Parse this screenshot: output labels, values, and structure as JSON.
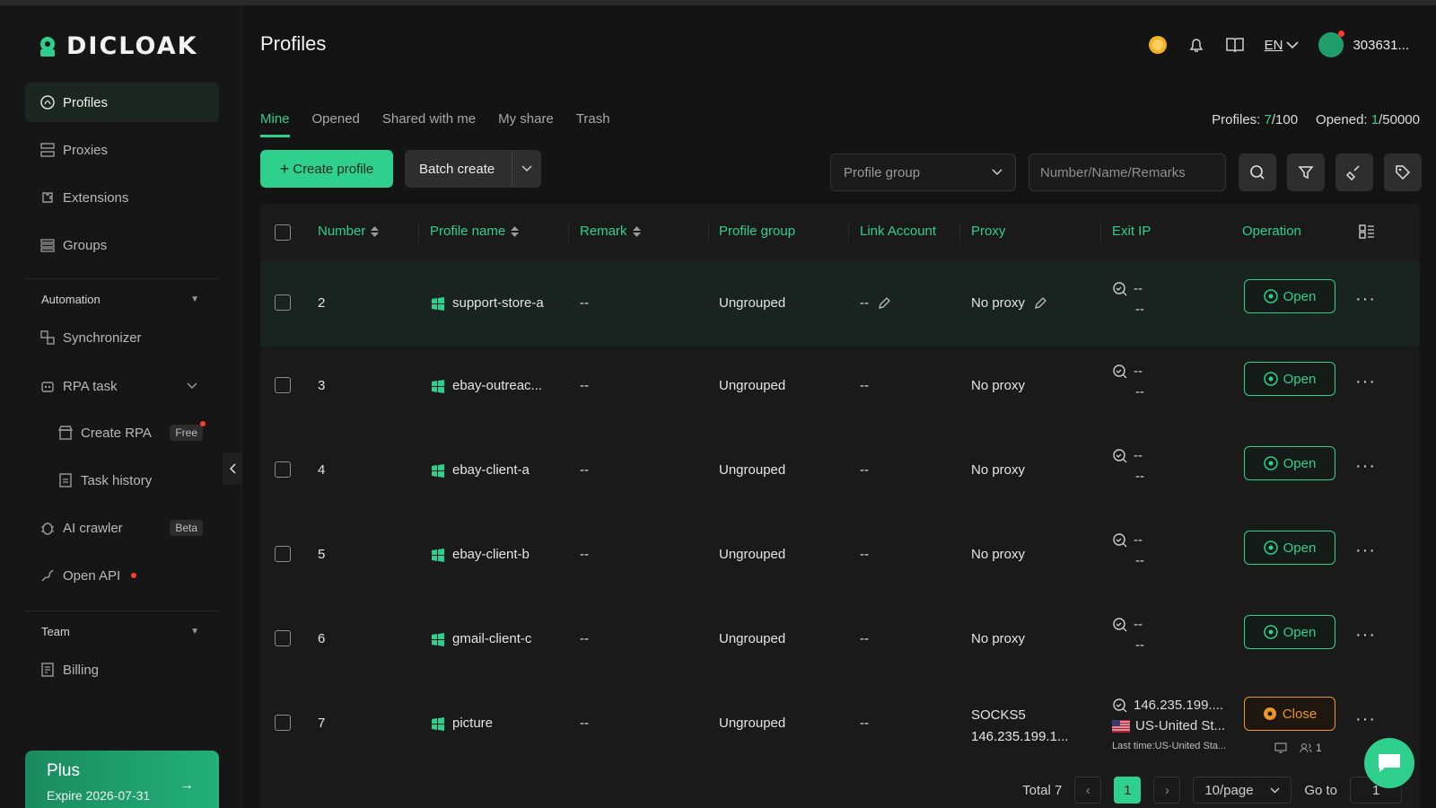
{
  "app": {
    "logo_text": "DICLOAK"
  },
  "colors": {
    "accent": "#2fd08e",
    "warning": "#e8962b",
    "background": "#141414"
  },
  "sidebar": {
    "items": [
      {
        "label": "Profiles",
        "icon": "fingerprint-icon"
      },
      {
        "label": "Proxies",
        "icon": "proxy-icon"
      },
      {
        "label": "Extensions",
        "icon": "extension-icon"
      },
      {
        "label": "Groups",
        "icon": "groups-icon"
      }
    ],
    "automation_title": "Automation",
    "automation_items": [
      {
        "label": "Synchronizer",
        "icon": "sync-icon"
      },
      {
        "label": "RPA task",
        "icon": "robot-icon"
      },
      {
        "label": "Create RPA",
        "icon": "store-icon",
        "badge": "Free"
      },
      {
        "label": "Task history",
        "icon": "document-icon"
      },
      {
        "label": "AI crawler",
        "icon": "bug-icon",
        "badge": "Beta"
      },
      {
        "label": "Open API",
        "icon": "api-icon"
      }
    ],
    "team_title": "Team",
    "team_items": [
      {
        "label": "Billing",
        "icon": "billing-icon"
      }
    ],
    "plan": {
      "name": "Plus",
      "expire": "Expire 2026-07-31"
    }
  },
  "header": {
    "title": "Profiles",
    "language": "EN",
    "user": "303631..."
  },
  "tabs": [
    "Mine",
    "Opened",
    "Shared with me",
    "My share",
    "Trash"
  ],
  "counts": {
    "profiles_label": "Profiles:",
    "profiles_used": "7",
    "profiles_total": "/100",
    "opened_label": "Opened:",
    "opened_used": "1",
    "opened_total": "/50000"
  },
  "toolbar": {
    "create_label": "Create profile",
    "batch_label": "Batch create",
    "group_select": "Profile group",
    "search_placeholder": "Number/Name/Remarks"
  },
  "table": {
    "columns": [
      "Number",
      "Profile name",
      "Remark",
      "Profile group",
      "Link Account",
      "Proxy",
      "Exit IP",
      "Operation"
    ],
    "rows": [
      {
        "number": "2",
        "name": "support-store-a",
        "remark": "--",
        "group": "Ungrouped",
        "link": "--",
        "proxy": "No proxy",
        "exit1": "--",
        "exit2": "--",
        "op": "Open"
      },
      {
        "number": "3",
        "name": "ebay-outreac...",
        "remark": "--",
        "group": "Ungrouped",
        "link": "--",
        "proxy": "No proxy",
        "exit1": "--",
        "exit2": "--",
        "op": "Open"
      },
      {
        "number": "4",
        "name": "ebay-client-a",
        "remark": "--",
        "group": "Ungrouped",
        "link": "--",
        "proxy": "No proxy",
        "exit1": "--",
        "exit2": "--",
        "op": "Open"
      },
      {
        "number": "5",
        "name": "ebay-client-b",
        "remark": "--",
        "group": "Ungrouped",
        "link": "--",
        "proxy": "No proxy",
        "exit1": "--",
        "exit2": "--",
        "op": "Open"
      },
      {
        "number": "6",
        "name": "gmail-client-c",
        "remark": "--",
        "group": "Ungrouped",
        "link": "--",
        "proxy": "No proxy",
        "exit1": "--",
        "exit2": "--",
        "op": "Open"
      },
      {
        "number": "7",
        "name": "picture",
        "remark": "--",
        "group": "Ungrouped",
        "link": "--",
        "proxy": "SOCKS5",
        "proxy2": "146.235.199.1...",
        "exit1": "146.235.199....",
        "exit2": "US-United St...",
        "exit3": "Last time:US-United Sta...",
        "op": "Close",
        "members": "1"
      }
    ]
  },
  "pagination": {
    "total": "Total 7",
    "page": "1",
    "per_page": "10/page",
    "goto_label": "Go to",
    "goto_value": "1"
  }
}
